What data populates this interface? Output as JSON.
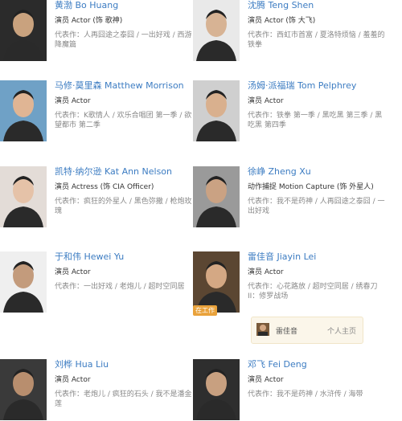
{
  "cards": [
    {
      "name": "黄渤 Bo Huang",
      "role": "演员 Actor (饰 歌神)",
      "works_label": "代表作：",
      "works": "人再囧途之泰囧 / 一出好戏 / 西游降魔篇",
      "bg": "#2b2b2b",
      "skin": "#c9a27e"
    },
    {
      "name": "沈腾 Teng Shen",
      "role": "演员 Actor (饰 大飞)",
      "works_label": "代表作：",
      "works": "西虹市首富 / 夏洛特烦恼 / 羞羞的铁拳",
      "bg": "#e9e9e9",
      "skin": "#d7b394"
    },
    {
      "name": "马修·莫里森 Matthew Morrison",
      "role": "演员 Actor",
      "works_label": "代表作：",
      "works": "K歌情人 / 欢乐合唱团 第一季 / 欲望都市 第二季",
      "bg": "#6fa1c6",
      "skin": "#e0b594"
    },
    {
      "name": "汤姆·派福瑞 Tom Pelphrey",
      "role": "演员 Actor",
      "works_label": "代表作：",
      "works": "铁拳 第一季 / 黑吃黑 第三季 / 黑吃黑 第四季",
      "bg": "#cfcfcf",
      "skin": "#d9b08e"
    },
    {
      "name": "凯特·纳尔逊 Kat Ann Nelson",
      "role": "演员 Actress (饰 CIA Officer)",
      "works_label": "代表作：",
      "works": "疯狂的外星人 / 黑色弥撒 / 枪炮玫瑰",
      "bg": "#e3dcd7",
      "skin": "#e5c2a8"
    },
    {
      "name": "徐峥 Zheng Xu",
      "role": "动作捕捉 Motion Capture (饰 外星人)",
      "works_label": "代表作：",
      "works": "我不是药神 / 人再囧途之泰囧 / 一出好戏",
      "bg": "#9a9a9a",
      "skin": "#caa283"
    },
    {
      "name": "于和伟 Hewei Yu",
      "role": "演员 Actor",
      "works_label": "代表作：",
      "works": "一出好戏 / 老炮儿 / 超时空同居",
      "bg": "#efefef",
      "skin": "#c39b7c"
    },
    {
      "name": "雷佳音 Jiayin Lei",
      "role": "演员 Actor",
      "works_label": "代表作：",
      "works": "心花路放 / 超时空同居 / 绣春刀II：修罗战场",
      "bg": "#5b4632",
      "skin": "#d4a884"
    },
    {
      "name": "刘桦 Hua Liu",
      "role": "演员 Actor",
      "works_label": "代表作：",
      "works": "老炮儿 / 疯狂的石头 / 我不是潘金莲",
      "bg": "#3a3a3a",
      "skin": "#b88e6e"
    },
    {
      "name": "邓飞 Fei Deng",
      "role": "演员 Actor",
      "works_label": "代表作：",
      "works": "我不是药神 / 水浒传 / 海带",
      "bg": "#2e2e2e",
      "skin": "#c8a080"
    }
  ],
  "badge": "在工作",
  "popup": {
    "name": "雷佳音",
    "link": "个人主页"
  }
}
